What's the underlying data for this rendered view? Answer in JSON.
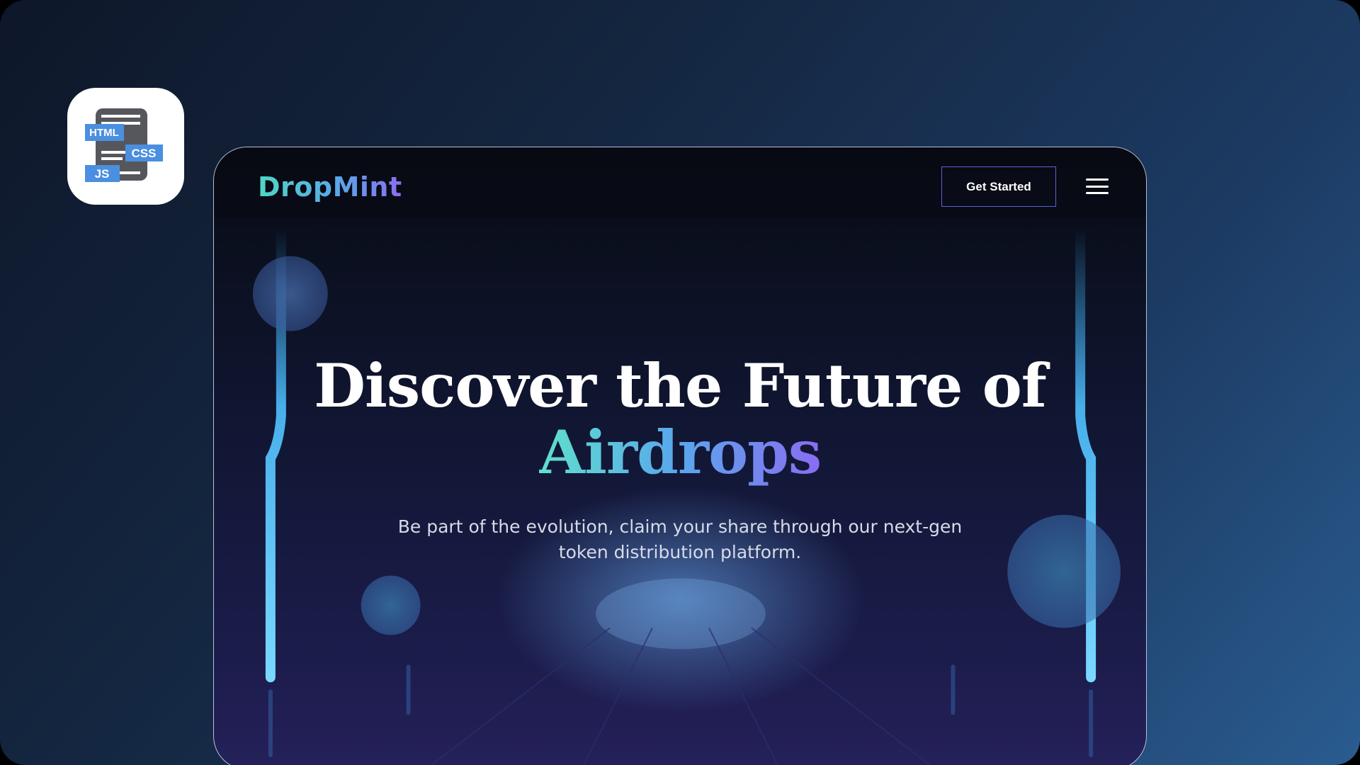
{
  "app_icon": {
    "icon": "html-css-js-icon",
    "labels": [
      "HTML",
      "CSS",
      "JS"
    ]
  },
  "site": {
    "logo": "DropMint",
    "cta_label": "Get Started",
    "menu_icon": "hamburger-menu-icon"
  },
  "hero": {
    "title_line1": "Discover the Future of",
    "title_line2": "Airdrops",
    "subtitle": "Be part of the evolution, claim your share through our next-gen token distribution platform."
  },
  "colors": {
    "accent_teal": "#4fd6c4",
    "accent_blue": "#59a8e8",
    "accent_violet": "#8b6cf0",
    "button_border": "#5a62d8"
  }
}
